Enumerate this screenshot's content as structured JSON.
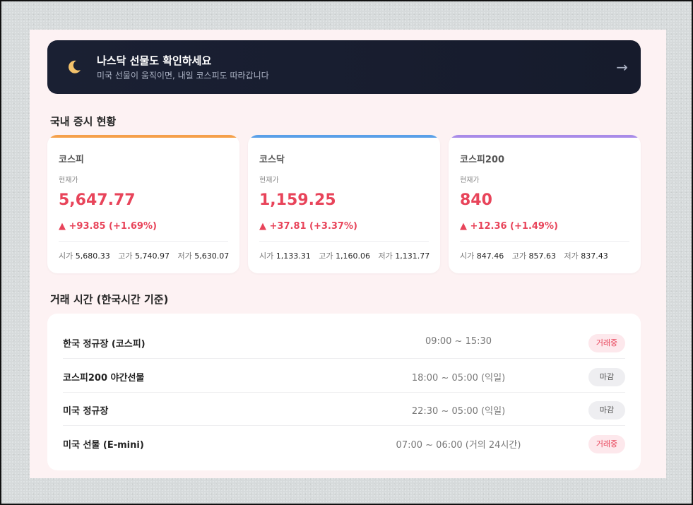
{
  "banner": {
    "icon": "moon-icon",
    "title": "나스닥 선물도 확인하세요",
    "subtitle": "미국 선물이 움직이면, 내일 코스피도 따라갑니다",
    "arrow": "→"
  },
  "domestic": {
    "title": "국내 증시 현황",
    "cards": [
      {
        "name": "코스피",
        "current_label": "현재가",
        "price": "5,647.77",
        "change": "▲ +93.85 (+1.69%)",
        "open_label": "시가",
        "open": "5,680.33",
        "high_label": "고가",
        "high": "5,740.97",
        "low_label": "저가",
        "low": "5,630.07",
        "accent": "#f5a04a"
      },
      {
        "name": "코스닥",
        "current_label": "현재가",
        "price": "1,159.25",
        "change": "▲ +37.81 (+3.37%)",
        "open_label": "시가",
        "open": "1,133.31",
        "high_label": "고가",
        "high": "1,160.06",
        "low_label": "저가",
        "low": "1,131.77",
        "accent": "#5aa0e8"
      },
      {
        "name": "코스피200",
        "current_label": "현재가",
        "price": "840",
        "change": "▲ +12.36 (+1.49%)",
        "open_label": "시가",
        "open": "847.46",
        "high_label": "고가",
        "high": "857.63",
        "low_label": "저가",
        "low": "837.43",
        "accent": "#a98be8"
      }
    ]
  },
  "hours": {
    "title": "거래 시간 (한국시간 기준)",
    "rows": [
      {
        "name": "한국 정규장 (코스피)",
        "time": "09:00 ~ 15:30",
        "status": "거래중"
      },
      {
        "name": "코스피200 야간선물",
        "time": "18:00 ~ 05:00 (익일)",
        "status": "마감"
      },
      {
        "name": "미국 정규장",
        "time": "22:30 ~ 05:00 (익일)",
        "status": "마감"
      },
      {
        "name": "미국 선물 (E-mini)",
        "time": "07:00 ~ 06:00 (거의 24시간)",
        "status": "거래중"
      }
    ]
  },
  "colors": {
    "up": "#e8445a",
    "banner_bg": "#1a2033",
    "panel_bg": "#fdf2f3"
  }
}
